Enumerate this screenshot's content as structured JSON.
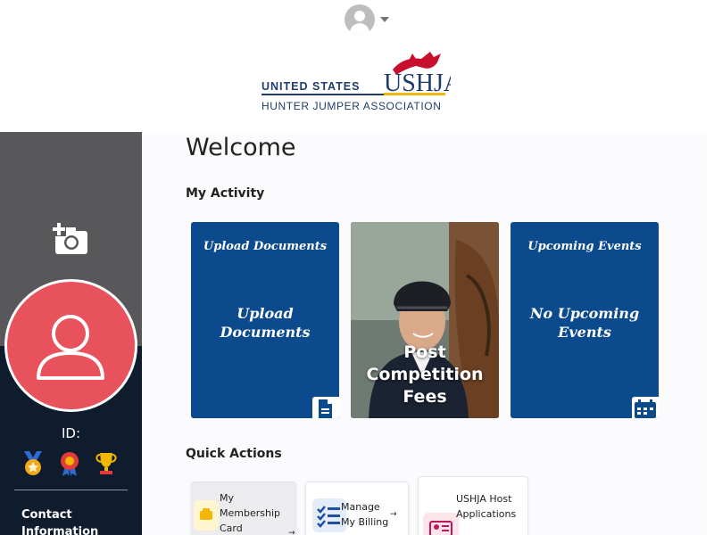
{
  "header": {
    "logo_text_top": "UNITED STATES",
    "logo_mark": "USHJA",
    "logo_text_bottom": "HUNTER JUMPER ASSOCIATION",
    "user_menu_icon": "account-circle-icon"
  },
  "sidebar": {
    "id_label": "ID:",
    "add_photo_icon": "add-photo-icon",
    "badges": [
      "medal-icon",
      "rosette-icon",
      "trophy-icon"
    ],
    "link": "Contact Information",
    "colors": {
      "bg": "#0f1c2e",
      "top": "#58585a",
      "avatar": "#e8525c"
    }
  },
  "main": {
    "welcome": "Welcome",
    "activity_title": "My Activity",
    "cards": [
      {
        "small": "Upload Documents",
        "big": "Upload Documents",
        "icon": "document-icon"
      },
      {
        "photo_text": "Post Competition Fees"
      },
      {
        "small": "Upcoming Events",
        "big": "No Upcoming Events",
        "icon": "calendar-icon"
      }
    ],
    "quick_title": "Quick Actions",
    "quick_actions": [
      {
        "label": "My Membership Card",
        "arrow": "→",
        "icon": "membership-card-icon"
      },
      {
        "label": "Manage My Billing",
        "arrow": "→",
        "icon": "checklist-icon"
      },
      {
        "label": "USHJA Host Applications",
        "icon": "id-card-icon"
      }
    ],
    "colors": {
      "card": "#0c4a8e"
    }
  }
}
